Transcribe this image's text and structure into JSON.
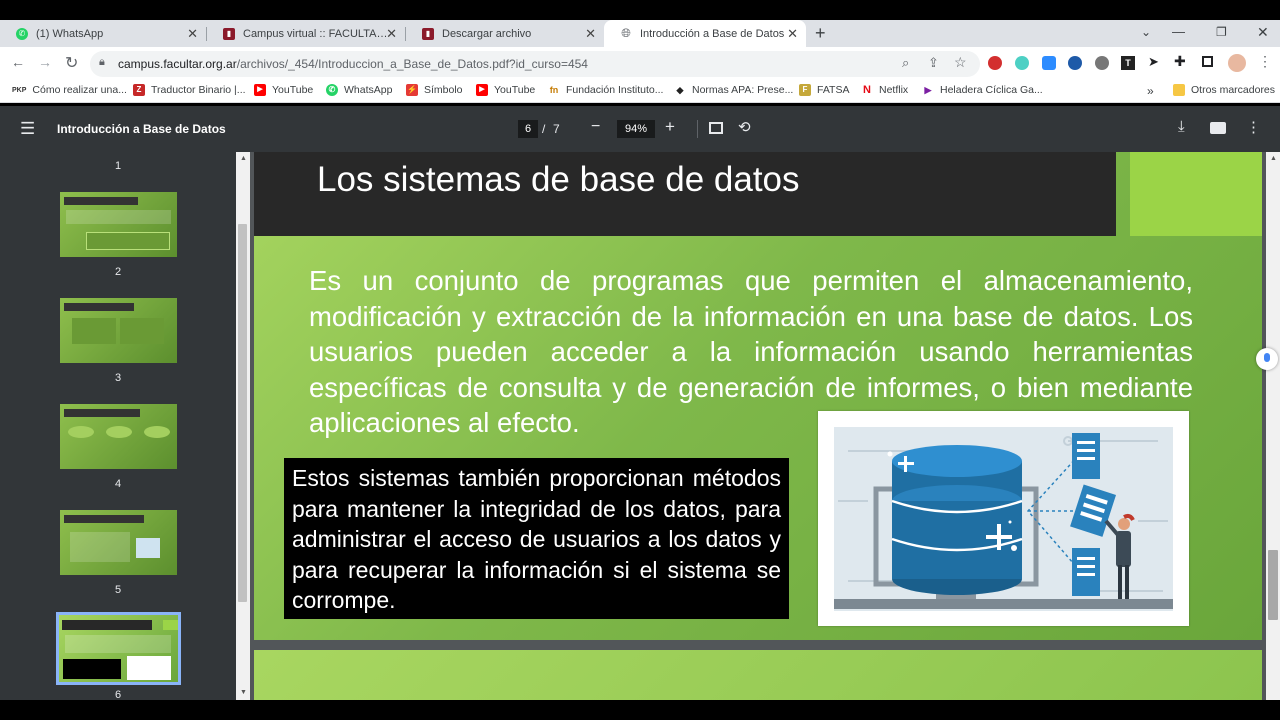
{
  "browser": {
    "tabs": [
      {
        "label": "(1) WhatsApp",
        "icon": "whatsapp-icon",
        "active": false
      },
      {
        "label": "Campus virtual :: FACULTAR [Mat",
        "icon": "campus-icon",
        "active": false
      },
      {
        "label": "Descargar archivo",
        "icon": "campus-icon",
        "active": false
      },
      {
        "label": "Introducción a Base de Datos",
        "icon": "globe-icon",
        "active": true
      }
    ],
    "url_domain": "campus.facultar.org.ar",
    "url_path": "/archivos/_454/Introduccion_a_Base_de_Datos.pdf?id_curso=454",
    "bookmarks": [
      {
        "label": "Cómo realizar una...",
        "badge": "PKP"
      },
      {
        "label": "Traductor Binario |...",
        "badge": "Z"
      },
      {
        "label": "YouTube",
        "badge": "▶"
      },
      {
        "label": "WhatsApp",
        "badge": "✆"
      },
      {
        "label": "Símbolo",
        "badge": "⚡"
      },
      {
        "label": "YouTube",
        "badge": "▶"
      },
      {
        "label": "Fundación Instituto...",
        "badge": "fn"
      },
      {
        "label": "Normas APA: Prese...",
        "badge": "◆"
      },
      {
        "label": "FATSA",
        "badge": "F"
      },
      {
        "label": "Netflix",
        "badge": "N"
      },
      {
        "label": "Heladera Cíclica Ga...",
        "badge": "▶"
      }
    ],
    "more_bookmarks": "»",
    "other_bookmarks": "Otros marcadores"
  },
  "pdf": {
    "title": "Introducción a Base de Datos",
    "current_page": "6",
    "page_separator": "/",
    "total_pages": "7",
    "zoom": "94%",
    "thumbnail_numbers": [
      "1",
      "2",
      "3",
      "4",
      "5",
      "6"
    ],
    "selected_page": 6
  },
  "slide": {
    "title": "Los sistemas de base de datos",
    "body": "Es un conjunto de programas que permiten el almacenamiento, modificación y extracción de la información en una base de datos. Los usuarios pueden acceder a la información usando herramientas específicas de consulta y de generación de informes, o bien mediante aplicaciones al efecto.",
    "box": "Estos sistemas también proporcionan métodos para mantener la integridad de los datos, para administrar el acceso de usuarios a los datos y para recuperar la información si el sistema se corrompe."
  },
  "colors": {
    "pdf_toolbar": "#323639",
    "viewer_bg": "#525659",
    "slide_green": "#7fb84a",
    "slide_header": "#282828",
    "accent_green": "#9bd447",
    "db_blue": "#1f6fa3"
  }
}
